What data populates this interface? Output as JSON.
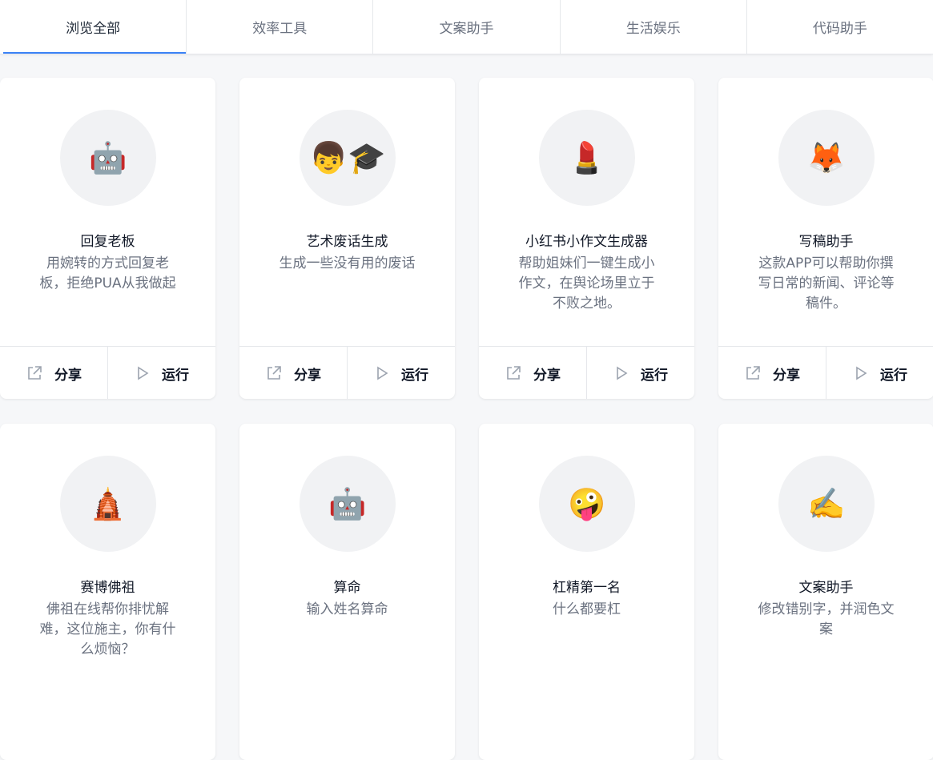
{
  "tabs": [
    {
      "label": "浏览全部",
      "active": true
    },
    {
      "label": "效率工具",
      "active": false
    },
    {
      "label": "文案助手",
      "active": false
    },
    {
      "label": "生活娱乐",
      "active": false
    },
    {
      "label": "代码助手",
      "active": false
    }
  ],
  "actions": {
    "share_label": "分享",
    "run_label": "运行"
  },
  "cards": [
    {
      "icon": "robot-icon",
      "glyph": "🤖",
      "title": "回复老板",
      "desc": "用婉转的方式回复老板，拒绝PUA从我做起"
    },
    {
      "icon": "student-icon",
      "glyph": "👦🎓",
      "title": "艺术废话生成",
      "desc": "生成一些没有用的废话"
    },
    {
      "icon": "lipstick-icon",
      "glyph": "💄",
      "title": "小红书小作文生成器",
      "desc": "帮助姐妹们一键生成小作文，在舆论场里立于不败之地。"
    },
    {
      "icon": "fox-icon",
      "glyph": "🦊",
      "title": "写稿助手",
      "desc": "这款APP可以帮助你撰写日常的新闻、评论等稿件。"
    },
    {
      "icon": "temple-icon",
      "glyph": "🛕",
      "title": "赛博佛祖",
      "desc": "佛祖在线帮你排忧解难，这位施主，你有什么烦恼？"
    },
    {
      "icon": "robot-icon",
      "glyph": "🤖",
      "title": "算命",
      "desc": "输入姓名算命"
    },
    {
      "icon": "zany-face-icon",
      "glyph": "🤪",
      "title": "杠精第一名",
      "desc": "什么都要杠"
    },
    {
      "icon": "writing-hand-icon",
      "glyph": "✍️",
      "title": "文案助手",
      "desc": "修改错别字，并润色文案"
    }
  ]
}
